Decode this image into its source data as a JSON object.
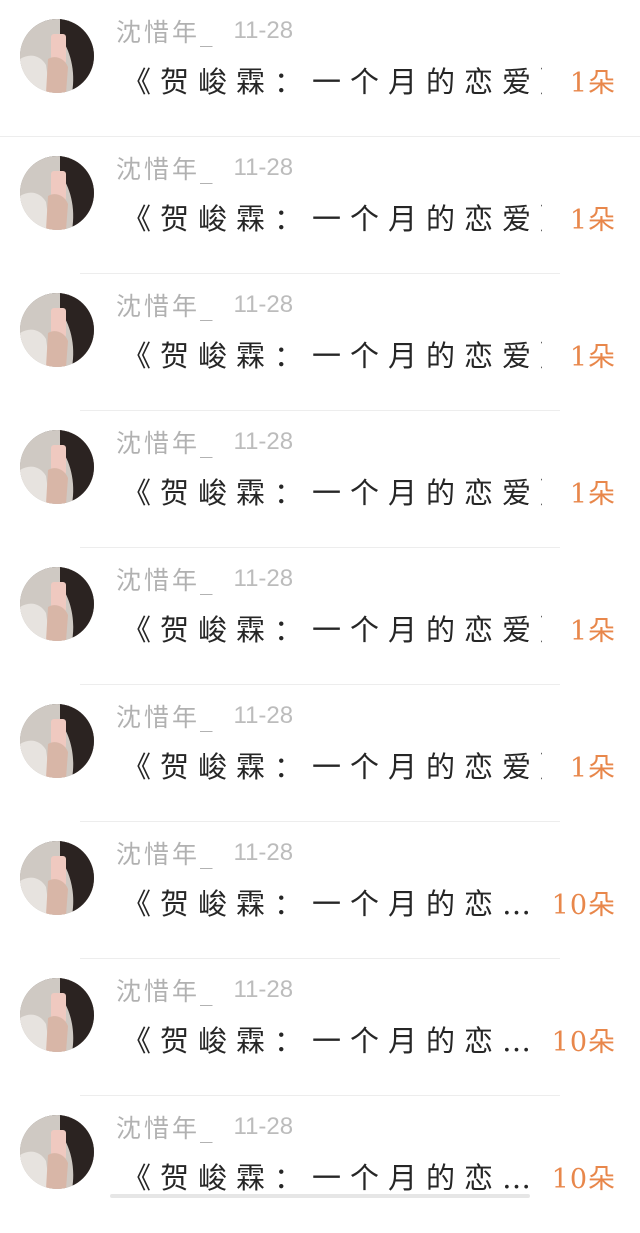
{
  "posts": [
    {
      "author": "沈惜年_",
      "date": "11-28",
      "title": "《贺峻霖：一个月的恋爱》",
      "count": "1朵"
    },
    {
      "author": "沈惜年_",
      "date": "11-28",
      "title": "《贺峻霖：一个月的恋爱》",
      "count": "1朵"
    },
    {
      "author": "沈惜年_",
      "date": "11-28",
      "title": "《贺峻霖：一个月的恋爱》",
      "count": "1朵"
    },
    {
      "author": "沈惜年_",
      "date": "11-28",
      "title": "《贺峻霖：一个月的恋爱》",
      "count": "1朵"
    },
    {
      "author": "沈惜年_",
      "date": "11-28",
      "title": "《贺峻霖：一个月的恋爱》",
      "count": "1朵"
    },
    {
      "author": "沈惜年_",
      "date": "11-28",
      "title": "《贺峻霖：一个月的恋爱》",
      "count": "1朵"
    },
    {
      "author": "沈惜年_",
      "date": "11-28",
      "title": "《贺峻霖：一个月的恋…",
      "count": "10朵"
    },
    {
      "author": "沈惜年_",
      "date": "11-28",
      "title": "《贺峻霖：一个月的恋…",
      "count": "10朵"
    },
    {
      "author": "沈惜年_",
      "date": "11-28",
      "title": "《贺峻霖：一个月的恋…",
      "count": "10朵"
    }
  ],
  "colors": {
    "accent": "#e8874b",
    "meta_text": "#b3b3b3",
    "title_text": "#262626",
    "divider": "#ededed"
  },
  "icons": {
    "avatar": "user-avatar-photo"
  }
}
